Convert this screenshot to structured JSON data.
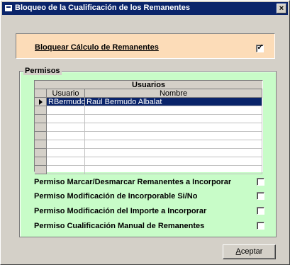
{
  "window": {
    "title": "Bloqueo de la Cualificación de los Remanentes",
    "close_label": "×"
  },
  "lock": {
    "label": "Bloquear Cálculo de Remanentes",
    "checked": true,
    "check_glyph": "✓"
  },
  "permisos": {
    "legend": "Permisos",
    "grid": {
      "group_header": "Usuarios",
      "columns": [
        "Usuario",
        "Nombre"
      ],
      "rows": [
        {
          "usuario": "RBermudo",
          "nombre": "Raúl Bermudo Albalat"
        }
      ]
    },
    "permissions": [
      {
        "label": "Permiso Marcar/Desmarcar Remanentes a Incorporar",
        "checked": false
      },
      {
        "label": "Permiso Modificación de Incorporable Si/No",
        "checked": false
      },
      {
        "label": "Permiso Modificación del Importe a Incorporar",
        "checked": false
      },
      {
        "label": "Permiso Cualificación Manual de Remanentes",
        "checked": false
      }
    ]
  },
  "buttons": {
    "accept_prefix": "A",
    "accept_rest": "ceptar"
  }
}
